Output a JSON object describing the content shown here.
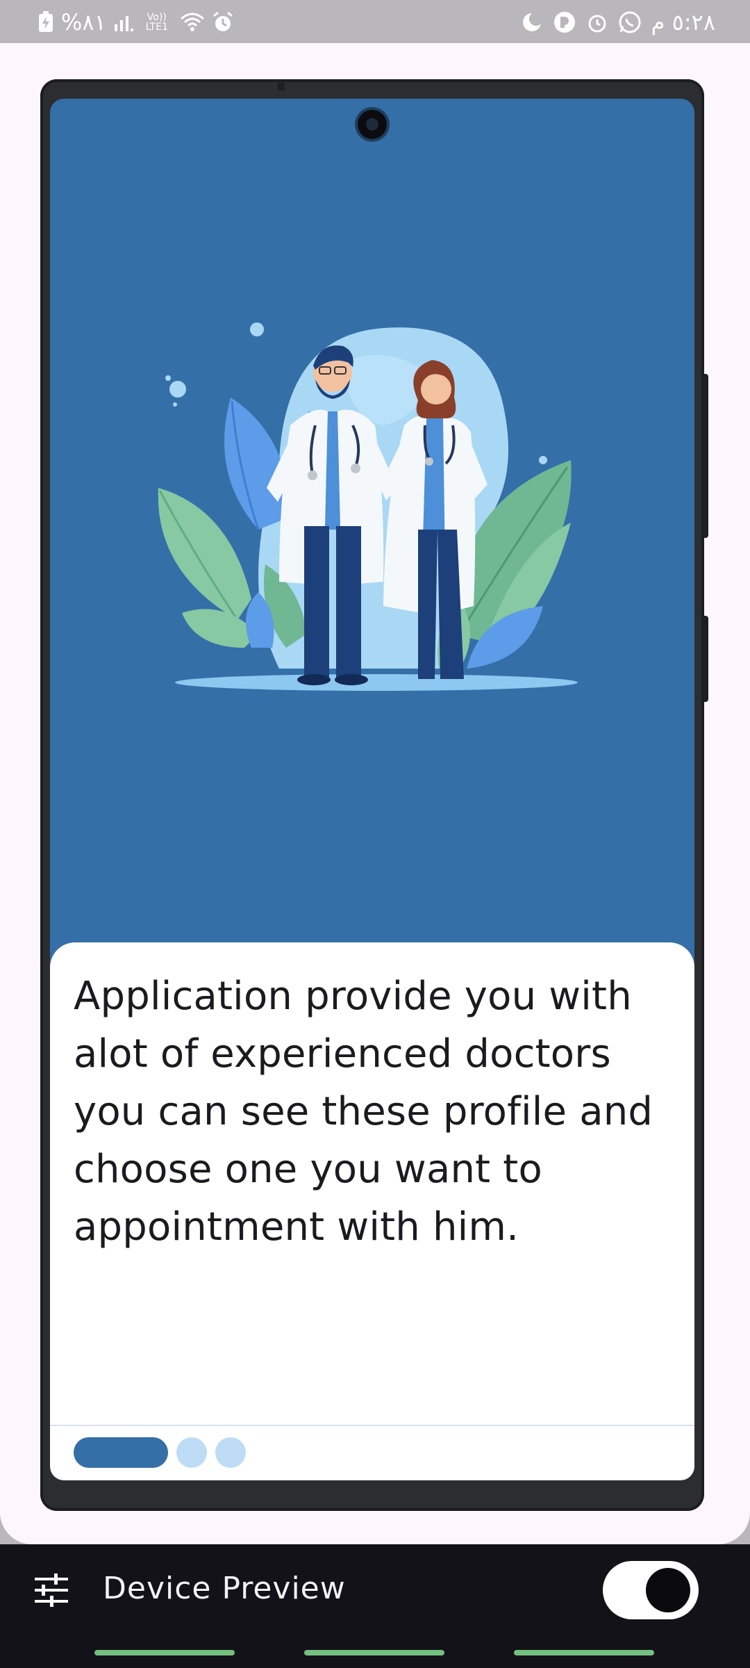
{
  "status_bar": {
    "battery_text": "%٨١",
    "time_text": "٥:٢٨ م",
    "lte_text": "Vo)) LTE1",
    "icons": [
      "charging-icon",
      "signal-icon",
      "lte-icon",
      "wifi-icon",
      "alarm-icon",
      "moon-icon",
      "app-icon",
      "alarm-icon",
      "whatsapp-icon"
    ]
  },
  "onboarding": {
    "illustration": "doctors-illustration",
    "description": "Application provide you with alot of experienced doctors you can see these profile and choose one you want to appointment with him.",
    "pages_total": 3,
    "current_page": 1
  },
  "bottom_bar": {
    "title": "Device Preview",
    "toggle_on": true
  },
  "colors": {
    "accent": "#346fa8",
    "indicator_inactive": "#bedcf6",
    "bar_bg": "#131218",
    "nav_pill": "#74c07f"
  }
}
